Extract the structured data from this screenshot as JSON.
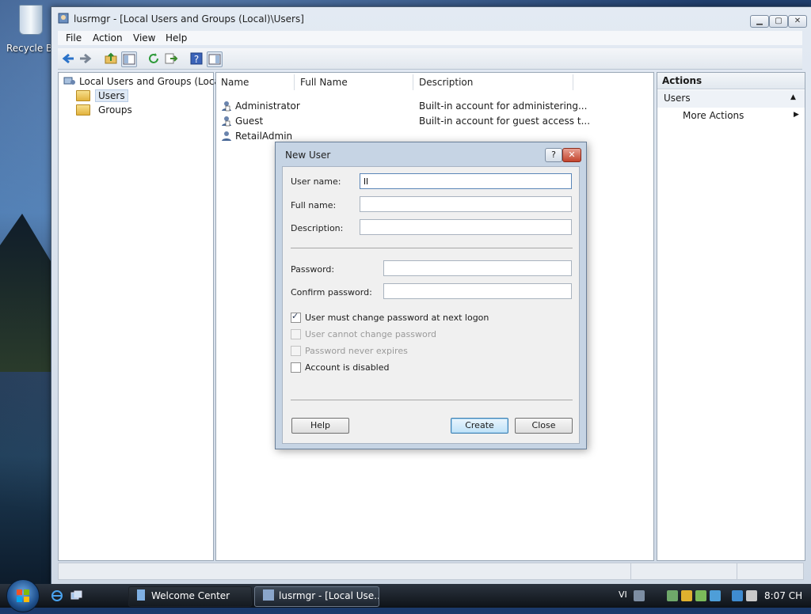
{
  "desktop": {
    "recycle_bin_label": "Recycle Bin"
  },
  "window": {
    "title": "lusrmgr - [Local Users and Groups (Local)\\Users]"
  },
  "menu": [
    "File",
    "Action",
    "View",
    "Help"
  ],
  "tree": {
    "root": "Local Users and Groups (Local)",
    "items": [
      "Users",
      "Groups"
    ]
  },
  "list": {
    "columns": [
      "Name",
      "Full Name",
      "Description"
    ],
    "rows": [
      {
        "name": "Administrator",
        "full_name": "",
        "description": "Built-in account for administering..."
      },
      {
        "name": "Guest",
        "full_name": "",
        "description": "Built-in account for guest access t..."
      },
      {
        "name": "RetailAdmin",
        "full_name": "",
        "description": ""
      }
    ]
  },
  "actions": {
    "title": "Actions",
    "section": "Users",
    "more": "More Actions"
  },
  "dialog": {
    "title": "New User",
    "help_glyph": "?",
    "close_glyph": "✕",
    "labels": {
      "user_name": "User name:",
      "full_name": "Full name:",
      "description": "Description:",
      "password": "Password:",
      "confirm_password": "Confirm password:"
    },
    "values": {
      "user_name": "ll",
      "full_name": "",
      "description": "",
      "password": "",
      "confirm_password": ""
    },
    "checkboxes": [
      {
        "label": "User must change password at next logon",
        "checked": true,
        "enabled": true
      },
      {
        "label": "User cannot change password",
        "checked": false,
        "enabled": false
      },
      {
        "label": "Password never expires",
        "checked": false,
        "enabled": false
      },
      {
        "label": "Account is disabled",
        "checked": false,
        "enabled": true
      }
    ],
    "buttons": {
      "help": "Help",
      "create": "Create",
      "close": "Close"
    }
  },
  "taskbar": {
    "buttons": [
      "Welcome Center",
      "lusrmgr - [Local Use..."
    ],
    "language": "VI",
    "clock": "8:07 CH"
  }
}
